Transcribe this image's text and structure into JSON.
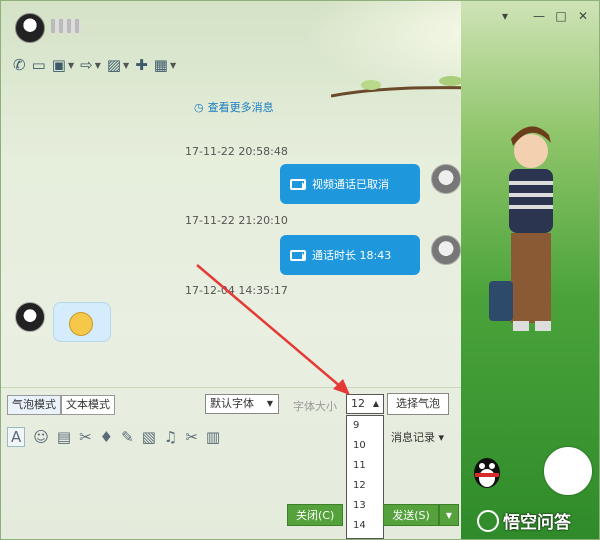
{
  "window": {
    "contact_name": "",
    "controls": {
      "minimize": "—",
      "maximize": "□",
      "close": "✕"
    }
  },
  "toolbar": {
    "items": [
      {
        "icon": "phone-icon",
        "glyph": "✆",
        "caret": false
      },
      {
        "icon": "video-camera-icon",
        "glyph": "▭",
        "caret": false
      },
      {
        "icon": "screen-share-icon",
        "glyph": "▣",
        "caret": true
      },
      {
        "icon": "file-transfer-icon",
        "glyph": "⇨",
        "caret": true
      },
      {
        "icon": "remote-assist-icon",
        "glyph": "▨",
        "caret": true
      },
      {
        "icon": "chat-comment-icon",
        "glyph": "✚",
        "caret": false
      },
      {
        "icon": "apps-grid-icon",
        "glyph": "▦",
        "caret": true
      }
    ]
  },
  "messages": {
    "more_link": "查看更多消息",
    "timestamps": [
      "17-11-22 20:58:48",
      "17-11-22 21:20:10",
      "17-12-04 14:35:17"
    ],
    "bubbles": [
      {
        "text": "视频通话已取消"
      },
      {
        "text": "通话时长 18:43"
      }
    ]
  },
  "input_area": {
    "mode_bubble": "气泡模式",
    "mode_text": "文本模式",
    "font_family": "默认字体",
    "font_size_label": "字体大小",
    "font_size_value": "12",
    "choose_bubble": "选择气泡",
    "size_options": [
      "9",
      "10",
      "11",
      "12",
      "13",
      "14"
    ],
    "message_record": "消息记录",
    "close_label": "关闭(C)",
    "send_label": "发送(S)"
  },
  "watermark": {
    "text": "悟空问答"
  },
  "colors": {
    "bubble_blue": "#1e97dd",
    "send_green": "#55a13c",
    "annotation_red": "#e53935"
  }
}
